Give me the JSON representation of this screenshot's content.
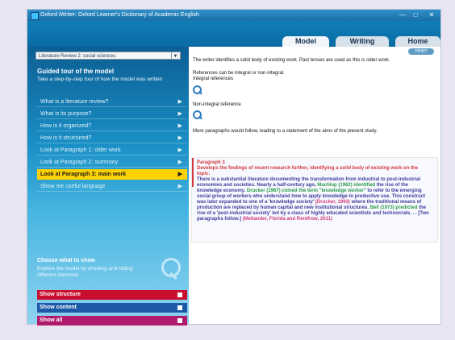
{
  "window": {
    "title": "Oxford iWriter: Oxford Learner's Dictionary of Academic English",
    "controls": {
      "minimize": "—",
      "maximize": "□",
      "close": "✕"
    }
  },
  "tabs": [
    {
      "label": "Model",
      "active": true
    },
    {
      "label": "Writing",
      "active": false
    },
    {
      "label": "Home",
      "active": false
    }
  ],
  "sidebar": {
    "select_value": "Literature Review 2: social sciences",
    "guide_title": "Guided tour of the model",
    "guide_desc": "Take a step-by-step tour of how the model was written",
    "items": [
      {
        "label": "What is a literature review?"
      },
      {
        "label": "What is its purpose?"
      },
      {
        "label": "How is it organized?"
      },
      {
        "label": "How is it structured?"
      },
      {
        "label": "Look at Paragraph 1: older work"
      },
      {
        "label": "Look at Paragraph 2: summary"
      },
      {
        "label": "Look at Paragraph 3: main work",
        "active": true
      },
      {
        "label": "Show me useful language"
      }
    ],
    "chooser_title": "Choose what to show",
    "chooser_desc": "Explore the model by showing and hiding different elements",
    "toggles": [
      {
        "label": "Show structure",
        "color": "#c8102e"
      },
      {
        "label": "Show content",
        "color": "#1c5aa8"
      },
      {
        "label": "Show all",
        "color": "#b01a6a"
      }
    ],
    "arrow": "▶"
  },
  "main": {
    "print_label": "PRINT",
    "lines": [
      "The writer identifies a solid body of existing work. Past tenses are used as this is older work.",
      "References can be integral or non-integral.",
      "Integral references",
      "Non-integral reference",
      "More paragraphs would follow, leading to a statement of the aims of the present study."
    ],
    "paragraph": {
      "title": "Paragraph 3",
      "title_line2": "Develops the findings of recent research further, identifying a solid body of existing work on the topic:",
      "p1": "There is a substantial literature documenting the transformation from industrial to post-industrial economies and societies. Nearly a half-century ago, ",
      "machlup": "Machlup (1962) identified",
      "p2": " the rise of the knowledge economy. ",
      "drucker": "Drucker (1967) coined the term \"knowledge worker\"",
      "p3": " to refer to the emerging social group of workers who understand how to apply knowledge to productive use. This construct was later expanded to one of a 'knowledge society' ",
      "drucker2": "(Drucker, 1993)",
      "p4": " where the traditional means of production are replaced by human capital and new institutional structures. ",
      "bell": "Bell (1973) predicted",
      "p5": " the rise of a 'post-industrial society' led by a class of highly educated scientists and technocrats. . . [Two paragraphs follow.] ",
      "cite": "(Mellander, Florida and Rentfrow, 2011)"
    }
  }
}
